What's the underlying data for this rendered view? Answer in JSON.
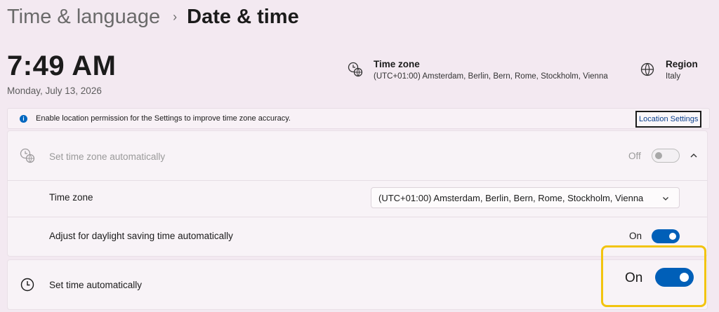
{
  "breadcrumb": {
    "parent": "Time & language",
    "separator": "›",
    "current": "Date & time"
  },
  "clock": {
    "time": "7:49 AM",
    "date": "Monday, July 13, 2026"
  },
  "header_info": {
    "timezone": {
      "title": "Time zone",
      "value": "(UTC+01:00) Amsterdam, Berlin, Bern, Rome, Stockholm, Vienna",
      "icon": "globe-clock-icon"
    },
    "region": {
      "title": "Region",
      "value": "Italy",
      "icon": "globe-icon"
    }
  },
  "banner": {
    "icon": "info-icon",
    "text": "Enable location permission for the Settings to improve time zone accuracy.",
    "button_label": "Location Settings"
  },
  "settings": {
    "auto_timezone": {
      "label": "Set time zone automatically",
      "state_label": "Off",
      "enabled": false,
      "expanded": true
    },
    "timezone_select": {
      "label": "Time zone",
      "value": "(UTC+01:00) Amsterdam, Berlin, Bern, Rome, Stockholm, Vienna"
    },
    "daylight_saving": {
      "label": "Adjust for daylight saving time automatically",
      "state_label": "On",
      "enabled": true
    },
    "set_time_auto": {
      "label": "Set time automatically",
      "state_label": "On",
      "enabled": true,
      "icon": "clock-icon"
    }
  },
  "colors": {
    "accent": "#005fb8",
    "highlight": "#f2c40f",
    "background": "#f3e9f1"
  }
}
